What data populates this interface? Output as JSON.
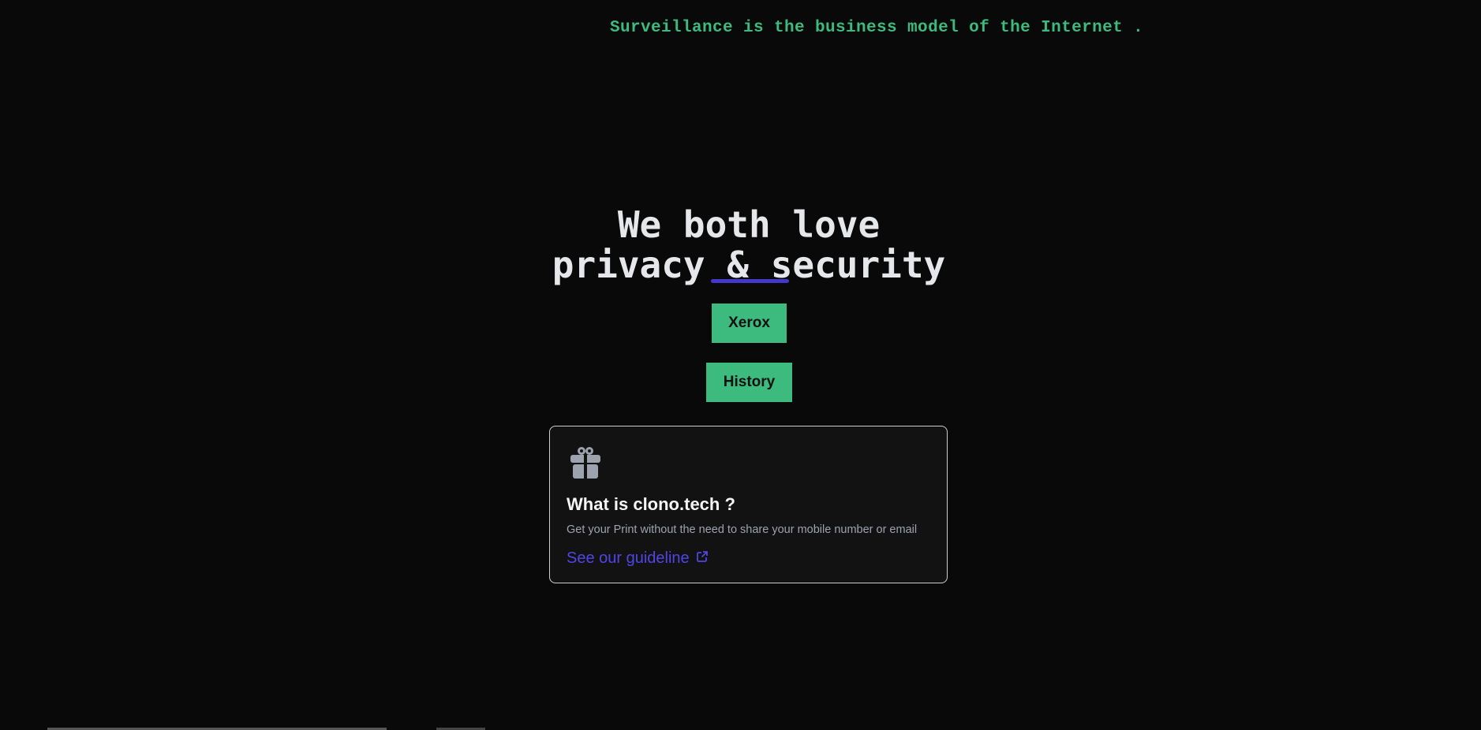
{
  "header": {
    "tagline": "Surveillance is the business model of the Internet ."
  },
  "hero": {
    "line1": "We both love",
    "line2": "privacy & security"
  },
  "buttons": {
    "xerox": "Xerox",
    "history": "History"
  },
  "info_card": {
    "icon": "gift-icon",
    "title": "What is clono.tech ?",
    "description": "Get your Print without the need to share your mobile number or email",
    "link_label": "See our guideline",
    "link_icon": "external-link-icon"
  },
  "colors": {
    "background": "#090909",
    "accent_green": "#3dba7e",
    "accent_indigo": "#4f46e5",
    "card_bg": "#121212"
  }
}
